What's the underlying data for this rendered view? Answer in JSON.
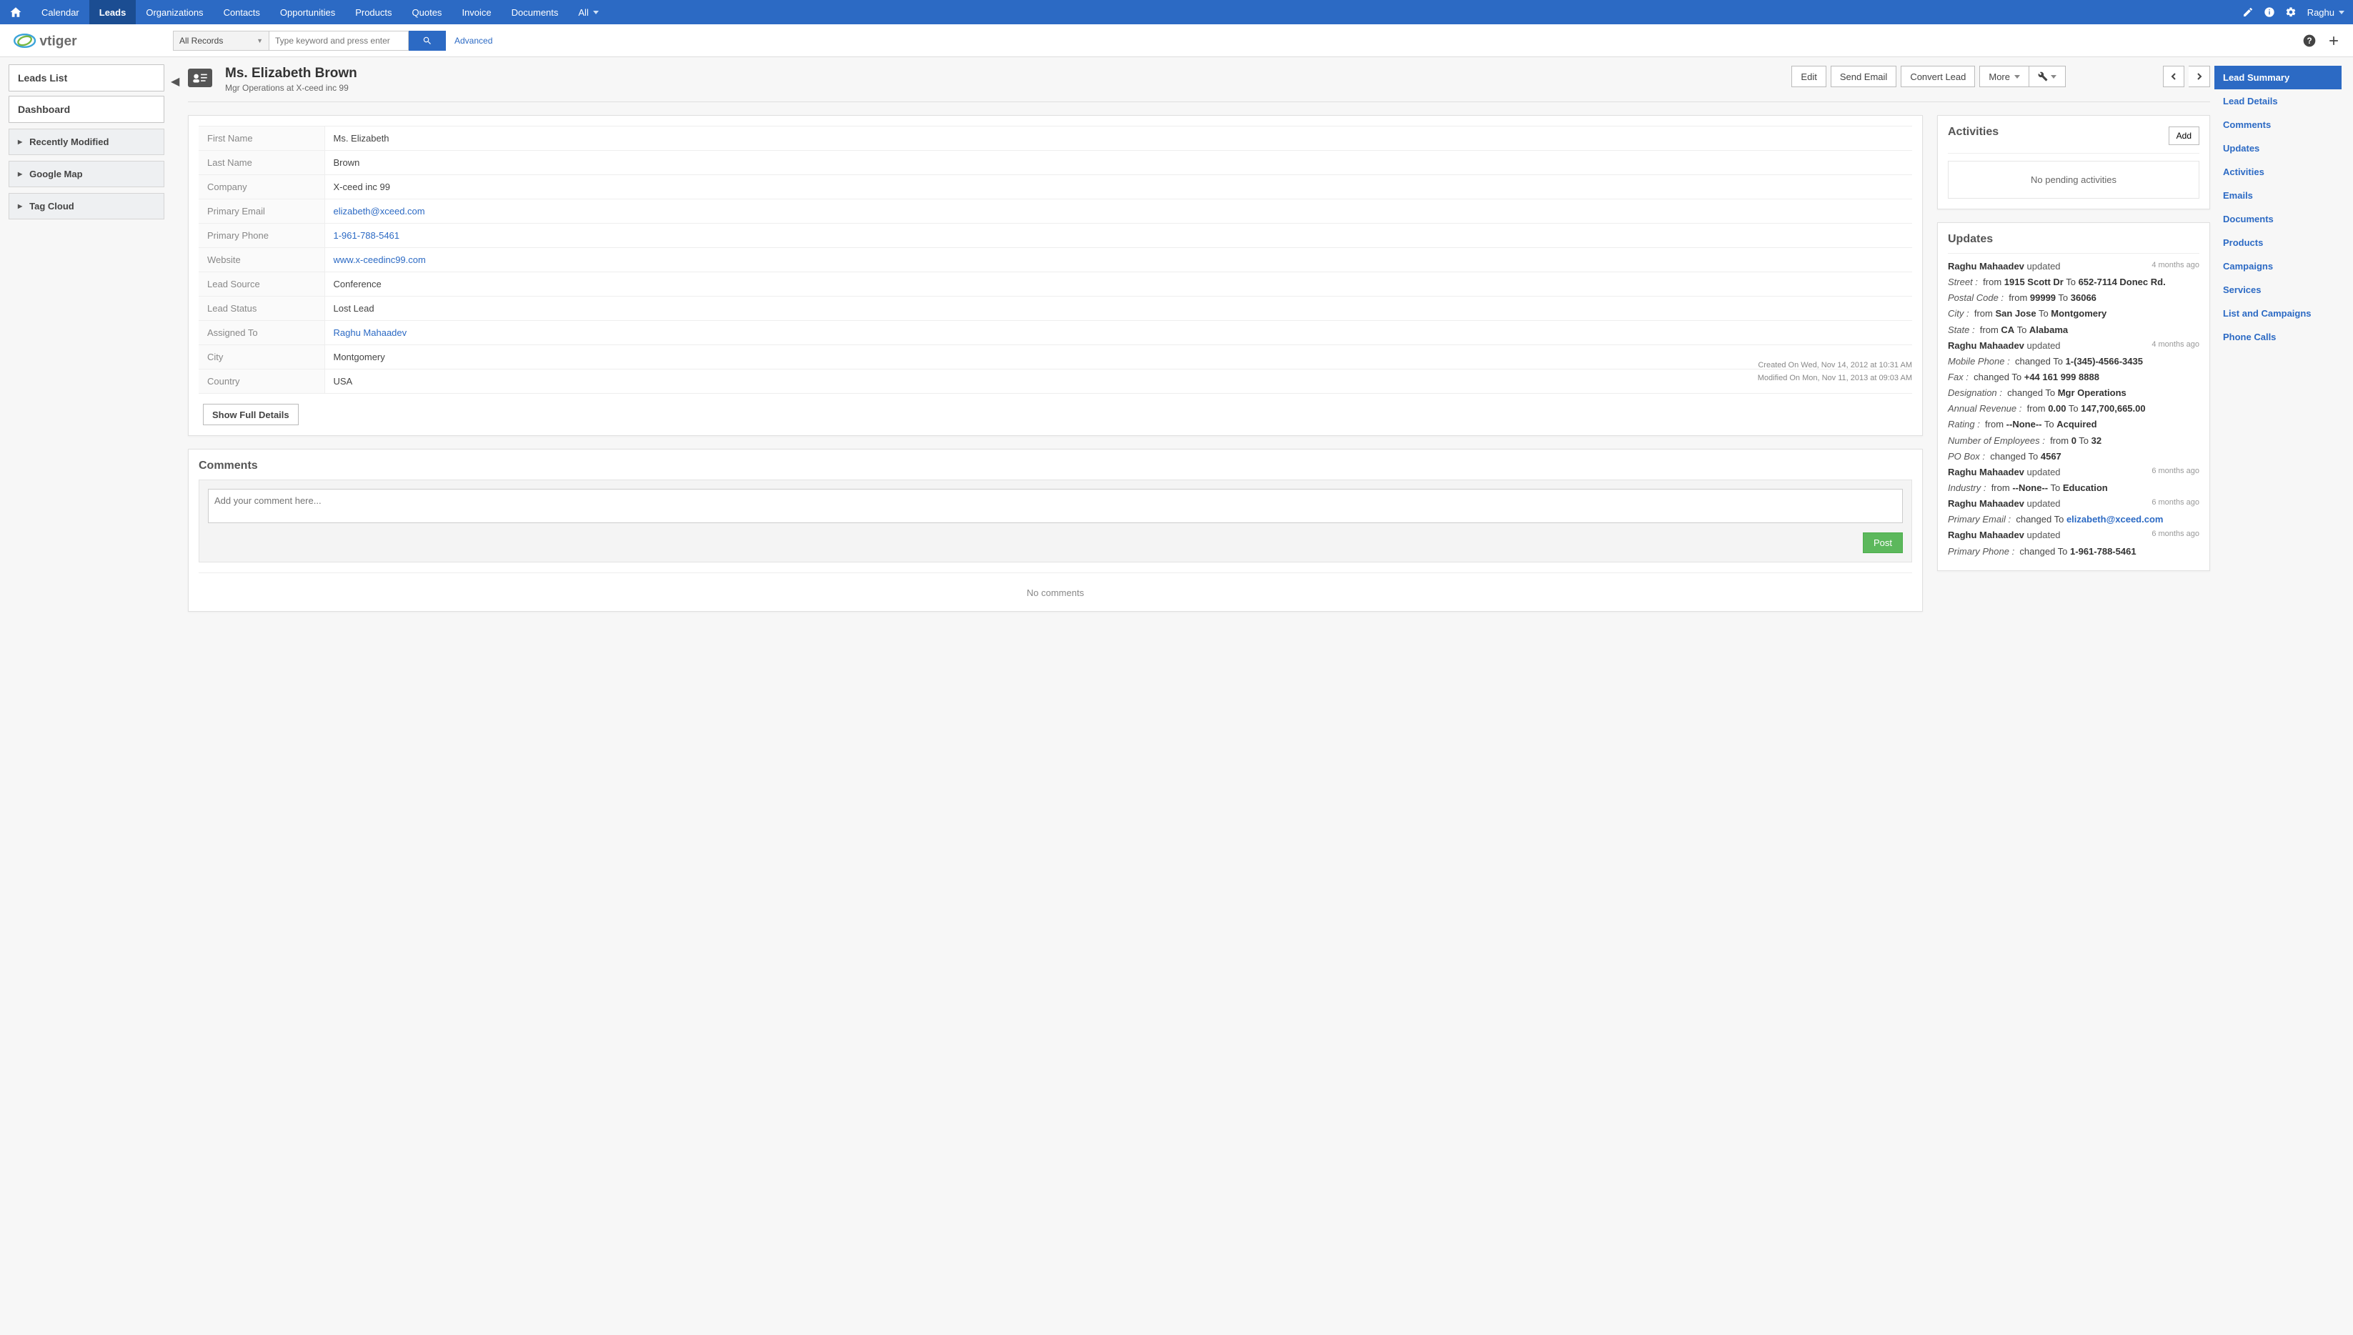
{
  "topnav": {
    "items": [
      "Calendar",
      "Leads",
      "Organizations",
      "Contacts",
      "Opportunities",
      "Products",
      "Quotes",
      "Invoice",
      "Documents",
      "All"
    ],
    "active_index": 1,
    "user": "Raghu"
  },
  "search": {
    "scope": "All Records",
    "placeholder": "Type keyword and press enter",
    "advanced": "Advanced"
  },
  "sidebar": {
    "leads_list": "Leads List",
    "dashboard": "Dashboard",
    "widgets": [
      "Recently Modified",
      "Google Map",
      "Tag Cloud"
    ]
  },
  "record": {
    "title": "Ms. Elizabeth Brown",
    "subtitle": "Mgr Operations at X-ceed inc 99",
    "buttons": {
      "edit": "Edit",
      "send_email": "Send Email",
      "convert": "Convert Lead",
      "more": "More"
    },
    "details": [
      {
        "label": "First Name",
        "value": "Ms. Elizabeth",
        "link": false
      },
      {
        "label": "Last Name",
        "value": "Brown",
        "link": false
      },
      {
        "label": "Company",
        "value": "X-ceed inc 99",
        "link": false
      },
      {
        "label": "Primary Email",
        "value": "elizabeth@xceed.com",
        "link": true
      },
      {
        "label": "Primary Phone",
        "value": "1-961-788-5461",
        "link": true
      },
      {
        "label": "Website",
        "value": "www.x-ceedinc99.com",
        "link": true
      },
      {
        "label": "Lead Source",
        "value": "Conference",
        "link": false
      },
      {
        "label": "Lead Status",
        "value": "Lost Lead",
        "link": false
      },
      {
        "label": "Assigned To",
        "value": "Raghu Mahaadev",
        "link": true
      },
      {
        "label": "City",
        "value": "Montgomery",
        "link": false
      },
      {
        "label": "Country",
        "value": "USA",
        "link": false
      }
    ],
    "show_full": "Show Full Details",
    "created": "Created On Wed, Nov 14, 2012 at 10:31 AM",
    "modified": "Modified On Mon, Nov 11, 2013 at 09:03 AM"
  },
  "comments": {
    "title": "Comments",
    "placeholder": "Add your comment here...",
    "post": "Post",
    "empty": "No comments"
  },
  "activities": {
    "title": "Activities",
    "add": "Add",
    "empty": "No pending activities"
  },
  "updates": {
    "title": "Updates",
    "groups": [
      {
        "who": "Raghu Mahaadev",
        "action": "updated",
        "ago": "4 months ago",
        "changes": [
          {
            "field": "Street",
            "text": "from",
            "from": "1915 Scott Dr",
            "mid": "To",
            "to": "652-7114 Donec Rd."
          },
          {
            "field": "Postal Code",
            "text": "from",
            "from": "99999",
            "mid": "To",
            "to": "36066"
          },
          {
            "field": "City",
            "text": "from",
            "from": "San Jose",
            "mid": "To",
            "to": "Montgomery"
          },
          {
            "field": "State",
            "text": "from",
            "from": "CA",
            "mid": "To",
            "to": "Alabama"
          }
        ]
      },
      {
        "who": "Raghu Mahaadev",
        "action": "updated",
        "ago": "4 months ago",
        "changes": [
          {
            "field": "Mobile Phone",
            "text": "changed To",
            "to": "1-(345)-4566-3435"
          },
          {
            "field": "Fax",
            "text": "changed To",
            "to": "+44 161 999 8888"
          },
          {
            "field": "Designation",
            "text": "changed To",
            "to": "Mgr Operations"
          },
          {
            "field": "Annual Revenue",
            "text": "from",
            "from": "0.00",
            "mid": "To",
            "to": "147,700,665.00"
          },
          {
            "field": "Rating",
            "text": "from",
            "from": "--None--",
            "mid": "To",
            "to": "Acquired"
          },
          {
            "field": "Number of Employees",
            "text": "from",
            "from": "0",
            "mid": "To",
            "to": "32"
          },
          {
            "field": "PO Box",
            "text": "changed To",
            "to": "4567"
          }
        ]
      },
      {
        "who": "Raghu Mahaadev",
        "action": "updated",
        "ago": "6 months ago",
        "changes": [
          {
            "field": "Industry",
            "text": "from",
            "from": "--None--",
            "mid": "To",
            "to": "Education"
          }
        ]
      },
      {
        "who": "Raghu Mahaadev",
        "action": "updated",
        "ago": "6 months ago",
        "changes": [
          {
            "field": "Primary Email",
            "text": "changed To",
            "to": "elizabeth@xceed.com",
            "link": true
          }
        ]
      },
      {
        "who": "Raghu Mahaadev",
        "action": "updated",
        "ago": "6 months ago",
        "changes": [
          {
            "field": "Primary Phone",
            "text": "changed To",
            "to": "1-961-788-5461"
          }
        ]
      }
    ]
  },
  "related": {
    "tabs": [
      "Lead Summary",
      "Lead Details",
      "Comments",
      "Updates",
      "Activities",
      "Emails",
      "Documents",
      "Products",
      "Campaigns",
      "Services",
      "List and Campaigns",
      "Phone Calls"
    ],
    "active_index": 0
  }
}
